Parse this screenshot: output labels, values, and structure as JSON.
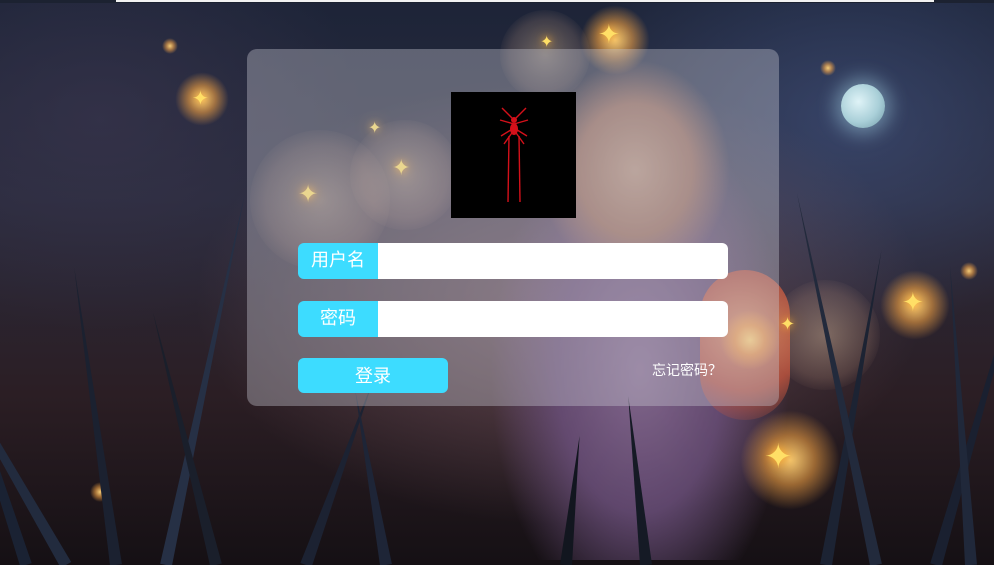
{
  "login": {
    "username_label": "用户名",
    "username_value": "",
    "password_label": "密码",
    "password_value": "",
    "submit_label": "登录",
    "forgot_label": "忘记密码？"
  },
  "icons": {
    "avatar": "spider-logo",
    "moon": "moon",
    "butterflies": "glowing-butterfly"
  },
  "colors": {
    "accent": "#3ddcff",
    "panel": "rgba(200,200,210,0.38)",
    "avatar_bg": "#000000",
    "spider": "#d4101a"
  }
}
